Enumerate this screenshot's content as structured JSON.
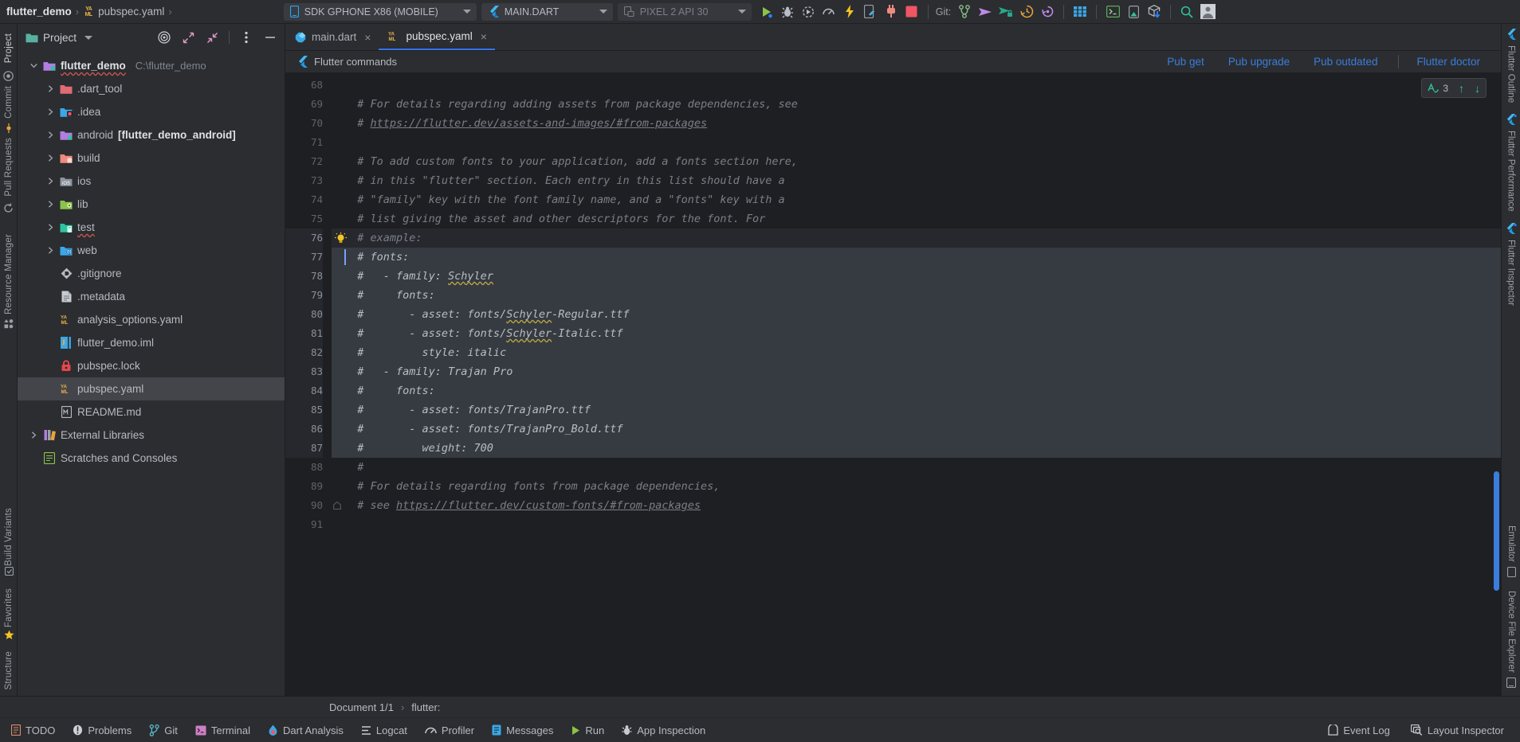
{
  "breadcrumb": {
    "project": "flutter_demo",
    "sep1": "›",
    "file_icon": "yaml-icon",
    "file": "pubspec.yaml",
    "sep2": "›"
  },
  "toolbar": {
    "device_combo": "SDK GPHONE X86 (MOBILE)",
    "run_config_combo": "MAIN.DART",
    "emulator_combo": "PIXEL 2 API 30",
    "git_label": "Git:",
    "icons": [
      "run-icon",
      "debug-icon",
      "profile-icon",
      "gauge-icon",
      "hot-reload-icon",
      "open-devtools-icon",
      "plug-icon",
      "stop-icon"
    ],
    "git_icons": [
      "branch-icon",
      "push-icon",
      "pull-icon",
      "history-icon",
      "rollback-icon"
    ],
    "right_icons": [
      "grid-icon",
      "terminal-icon",
      "device-icon",
      "package-icon",
      "search-icon",
      "avatar-icon"
    ]
  },
  "left_strip": {
    "labels": [
      "Project",
      "Commit",
      "Pull Requests"
    ],
    "bottom_labels": [
      "Resource Manager",
      "Structure",
      "Favorites",
      "Build Variants"
    ]
  },
  "project_panel": {
    "title": "Project",
    "header_icons": [
      "target-icon",
      "expand-icon",
      "collapse-icon",
      "more-icon",
      "hide-icon"
    ],
    "tree": [
      {
        "indent": 0,
        "arrow": "open",
        "icon": "folder-module",
        "color": "#b07ee0",
        "label": "flutter_demo",
        "bold": true,
        "path": "C:\\flutter_demo",
        "squiggle": true,
        "selected": false
      },
      {
        "indent": 1,
        "arrow": "closed",
        "icon": "folder",
        "color": "#e06b74",
        "label": ".dart_tool",
        "bold": false,
        "path": "",
        "squiggle": false,
        "selected": false
      },
      {
        "indent": 1,
        "arrow": "closed",
        "icon": "folder-idea",
        "color": "#3aa8e8",
        "label": ".idea",
        "bold": false,
        "path": "",
        "squiggle": false,
        "selected": false
      },
      {
        "indent": 1,
        "arrow": "closed",
        "icon": "folder-module",
        "color": "#b07ee0",
        "label": "android ",
        "bold": false,
        "path": "",
        "bold_suffix": "[flutter_demo_android]",
        "squiggle": false,
        "selected": false
      },
      {
        "indent": 1,
        "arrow": "closed",
        "icon": "folder-excl",
        "color": "#ef8a80",
        "label": "build",
        "bold": false,
        "path": "",
        "squiggle": false,
        "selected": false
      },
      {
        "indent": 1,
        "arrow": "closed",
        "icon": "folder-ios",
        "color": "#8d949e",
        "label": "ios",
        "bold": false,
        "path": "",
        "squiggle": false,
        "selected": false
      },
      {
        "indent": 1,
        "arrow": "closed",
        "icon": "folder-src",
        "color": "#8bc34a",
        "label": "lib",
        "bold": false,
        "path": "",
        "squiggle": false,
        "selected": false
      },
      {
        "indent": 1,
        "arrow": "closed",
        "icon": "folder-test",
        "color": "#2ec4a0",
        "label": "test",
        "bold": false,
        "path": "",
        "squiggle": true,
        "selected": false
      },
      {
        "indent": 1,
        "arrow": "closed",
        "icon": "folder-web",
        "color": "#3aa8e8",
        "label": "web",
        "bold": false,
        "path": "",
        "squiggle": false,
        "selected": false
      },
      {
        "indent": 1,
        "arrow": "none",
        "icon": "git-file-icon",
        "color": "#9aa0a6",
        "label": ".gitignore",
        "bold": false,
        "path": "",
        "squiggle": false,
        "selected": false
      },
      {
        "indent": 1,
        "arrow": "none",
        "icon": "text-file-icon",
        "color": "#9aa0a6",
        "label": ".metadata",
        "bold": false,
        "path": "",
        "squiggle": false,
        "selected": false
      },
      {
        "indent": 1,
        "arrow": "none",
        "icon": "yaml-file-icon",
        "color": "#e8b34b",
        "label": "analysis_options.yaml",
        "bold": false,
        "path": "",
        "squiggle": false,
        "selected": false
      },
      {
        "indent": 1,
        "arrow": "none",
        "icon": "iml-file-icon",
        "color": "#3aa8e8",
        "label": "flutter_demo.iml",
        "bold": false,
        "path": "",
        "squiggle": false,
        "selected": false
      },
      {
        "indent": 1,
        "arrow": "none",
        "icon": "lock-file-icon",
        "color": "#e5484d",
        "label": "pubspec.lock",
        "bold": false,
        "path": "",
        "squiggle": false,
        "selected": false
      },
      {
        "indent": 1,
        "arrow": "none",
        "icon": "yaml-file-icon",
        "color": "#e8b34b",
        "label": "pubspec.yaml",
        "bold": false,
        "path": "",
        "squiggle": false,
        "selected": true
      },
      {
        "indent": 1,
        "arrow": "none",
        "icon": "md-file-icon",
        "color": "#9aa0a6",
        "label": "README.md",
        "bold": false,
        "path": "",
        "squiggle": false,
        "selected": false
      },
      {
        "indent": 0,
        "arrow": "closed",
        "icon": "library-icon",
        "color": "#b07ee0",
        "label": "External Libraries",
        "bold": false,
        "path": "",
        "squiggle": false,
        "selected": false
      },
      {
        "indent": 0,
        "arrow": "none",
        "icon": "scratch-icon",
        "color": "#8bc34a",
        "label": "Scratches and Consoles",
        "bold": false,
        "path": "",
        "squiggle": false,
        "selected": false
      }
    ]
  },
  "tabs": [
    {
      "label": "main.dart",
      "icon": "dart-icon",
      "active": false,
      "close": "×"
    },
    {
      "label": "pubspec.yaml",
      "icon": "yaml-icon",
      "active": true,
      "close": "×"
    }
  ],
  "command_bar": {
    "icon": "flutter-icon",
    "label": "Flutter commands",
    "links": [
      "Pub get",
      "Pub upgrade",
      "Pub outdated",
      "Flutter doctor"
    ]
  },
  "inspection_widget": {
    "icon": "inspection-icon",
    "count": "3",
    "up": "↑",
    "down": "↓"
  },
  "editor": {
    "first_line": 68,
    "selected_from": 77,
    "selected_to": 87,
    "caret_line": 77,
    "bulb_line": 76,
    "fold_line": 90,
    "lines": [
      {
        "n": 68,
        "text": ""
      },
      {
        "n": 69,
        "text": "  # For details regarding adding assets from package dependencies, see"
      },
      {
        "n": 70,
        "text": "  # ",
        "link": "https://flutter.dev/assets-and-images/#from-packages"
      },
      {
        "n": 71,
        "text": ""
      },
      {
        "n": 72,
        "text": "  # To add custom fonts to your application, add a fonts section here,"
      },
      {
        "n": 73,
        "text": "  # in this \"flutter\" section. Each entry in this list should have a"
      },
      {
        "n": 74,
        "text": "  # \"family\" key with the font family name, and a \"fonts\" key with a"
      },
      {
        "n": 75,
        "text": "  # list giving the asset and other descriptors for the font. For"
      },
      {
        "n": 76,
        "text": "  # example:"
      },
      {
        "n": 77,
        "text": "  # fonts:"
      },
      {
        "n": 78,
        "text": "  #   - family: ",
        "sq": "Schyler"
      },
      {
        "n": 79,
        "text": "  #     fonts:"
      },
      {
        "n": 80,
        "text": "  #       - asset: fonts/",
        "sq": "Schyler",
        "tail": "-Regular.ttf"
      },
      {
        "n": 81,
        "text": "  #       - asset: fonts/",
        "sq": "Schyler",
        "tail": "-Italic.ttf"
      },
      {
        "n": 82,
        "text": "  #         style: italic"
      },
      {
        "n": 83,
        "text": "  #   - family: Trajan Pro"
      },
      {
        "n": 84,
        "text": "  #     fonts:"
      },
      {
        "n": 85,
        "text": "  #       - asset: fonts/TrajanPro.ttf"
      },
      {
        "n": 86,
        "text": "  #       - asset: fonts/TrajanPro_Bold.ttf"
      },
      {
        "n": 87,
        "text": "  #         weight: 700"
      },
      {
        "n": 88,
        "text": "  #"
      },
      {
        "n": 89,
        "text": "  # For details regarding fonts from package dependencies,"
      },
      {
        "n": 90,
        "text": "  # see ",
        "link": "https://flutter.dev/custom-fonts/#from-packages"
      },
      {
        "n": 91,
        "text": ""
      }
    ]
  },
  "right_strip": {
    "labels": [
      "Flutter Outline",
      "Flutter Performance",
      "Flutter Inspector"
    ],
    "bottom_labels": [
      "Device File Explorer",
      "Emulator"
    ]
  },
  "status_line": {
    "document": "Document 1/1",
    "arrow": "›",
    "context": "flutter:"
  },
  "bottom_bar": {
    "left_items": [
      {
        "label": "TODO",
        "icon": "todo-icon"
      },
      {
        "label": "Problems",
        "icon": "problems-icon"
      },
      {
        "label": "Git",
        "icon": "git-icon"
      },
      {
        "label": "Terminal",
        "icon": "terminal-icon"
      },
      {
        "label": "Dart Analysis",
        "icon": "dart-analysis-icon"
      },
      {
        "label": "Logcat",
        "icon": "logcat-icon"
      },
      {
        "label": "Profiler",
        "icon": "profiler-icon"
      },
      {
        "label": "Messages",
        "icon": "messages-icon"
      },
      {
        "label": "Run",
        "icon": "run-icon"
      },
      {
        "label": "App Inspection",
        "icon": "app-inspection-icon"
      }
    ],
    "right_items": [
      {
        "label": "Event Log",
        "icon": "event-log-icon"
      },
      {
        "label": "Layout Inspector",
        "icon": "layout-inspector-icon"
      }
    ]
  },
  "colors": {
    "accent_blue": "#3b7ddd",
    "selection": "#363a41",
    "bg": "#2b2d30",
    "editor_bg": "#1e1f22"
  }
}
